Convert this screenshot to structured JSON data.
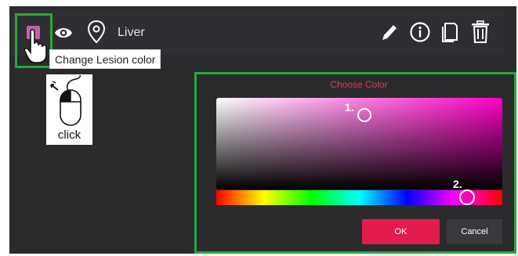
{
  "lesion": {
    "name": "Liver",
    "color": "#c163a8"
  },
  "tooltip": {
    "text": "Change Lesion color"
  },
  "hint": {
    "label": "click"
  },
  "picker": {
    "title": "Choose Color",
    "marker_1": "1.",
    "marker_2": "2.",
    "ok_label": "OK",
    "cancel_label": "Cancel",
    "hue_value": 0.89
  },
  "icons": [
    "eye-icon",
    "location-pin-icon",
    "pencil-icon",
    "info-icon",
    "copy-icon",
    "trash-icon",
    "hand-pointer-icon",
    "mouse-icon"
  ],
  "colors": {
    "highlight": "#27a83a",
    "accent": "#e31c4e",
    "background": "#2b2b2e"
  }
}
